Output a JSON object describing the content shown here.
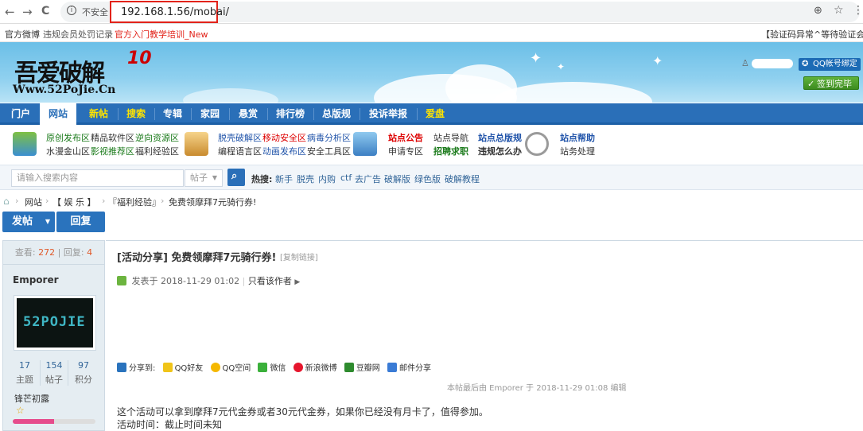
{
  "browser": {
    "back": "←",
    "forward": "→",
    "reload": "C",
    "security": "不安全",
    "url": "192.168.1.56/mobai/"
  },
  "bookmarks": [
    "官方微博",
    "违规会员处罚记录",
    "官方入门教学培训_New",
    "【验证码异常^等待验证会员"
  ],
  "header": {
    "logo_main": "吾爱破解",
    "logo_sub": "Www.52PoJie.Cn",
    "logo_badge": "10",
    "qq_bind": "QQ帐号绑定",
    "sign_in": "签到完毕"
  },
  "nav": [
    "门户",
    "网站",
    "新帖",
    "搜索",
    "专辑",
    "家园",
    "悬赏",
    "排行榜",
    "总版规",
    "投诉举报",
    "爱盘"
  ],
  "quick_links": {
    "col1_row1": [
      "原创发布区",
      "精品软件区",
      "逆向资源区"
    ],
    "col1_row2": [
      "水漫金山区",
      "影视推荐区",
      "福利经验区"
    ],
    "col2_row1": [
      "脱壳破解区",
      "移动安全区",
      "病毒分析区"
    ],
    "col2_row2": [
      "编程语言区",
      "动画发布区",
      "安全工具区"
    ],
    "col3_row1": [
      "站点公告",
      "站点导航",
      "站点总版规"
    ],
    "col3_row2": [
      "申请专区",
      "招聘求职",
      "违规怎么办"
    ],
    "col4_row1": [
      "站点帮助"
    ],
    "col4_row2": [
      "站务处理"
    ]
  },
  "search": {
    "placeholder": "请输入搜索内容",
    "type": "帖子",
    "hot_label": "热搜:",
    "hot": [
      "新手",
      "脱壳",
      "内购",
      "ctf",
      "去广告",
      "破解版",
      "绿色版",
      "破解教程"
    ]
  },
  "breadcrumb": [
    "网站",
    "【 娱 乐 】",
    "『福利经验』",
    "免费领摩拜7元骑行券!"
  ],
  "buttons": {
    "post": "发帖",
    "reply": "回复"
  },
  "post": {
    "views_label": "查看:",
    "views": "272",
    "replies_label": "回复:",
    "replies": "4",
    "title": "[活动分享] 免费领摩拜7元骑行券!",
    "copy_link": "[复制链接]",
    "posted_label": "发表于",
    "posted_time": "2018-11-29 01:02",
    "author_only": "只看该作者",
    "share_label": "分享到:",
    "share": [
      "QQ好友",
      "QQ空间",
      "微信",
      "新浪微博",
      "豆瓣网",
      "邮件分享"
    ],
    "edited": "本帖最后由 Emporer 于 2018-11-29 01:08 编辑",
    "body_line1": "这个活动可以拿到摩拜7元代金券或者30元代金券，如果你已经没有月卡了，值得参加。",
    "body_line2": "活动时间：截止时间未知"
  },
  "user": {
    "name": "Emporer",
    "avatar_text": "52POJIE",
    "topics": "17",
    "topics_label": "主题",
    "posts": "154",
    "posts_label": "帖子",
    "points": "97",
    "points_label": "积分",
    "rank": "锋芒初露",
    "progress": 0.5
  },
  "colors": {
    "nav_blue": "#2a6fb8",
    "url_highlight": "#e2231a",
    "progress": "#e64c8c"
  }
}
